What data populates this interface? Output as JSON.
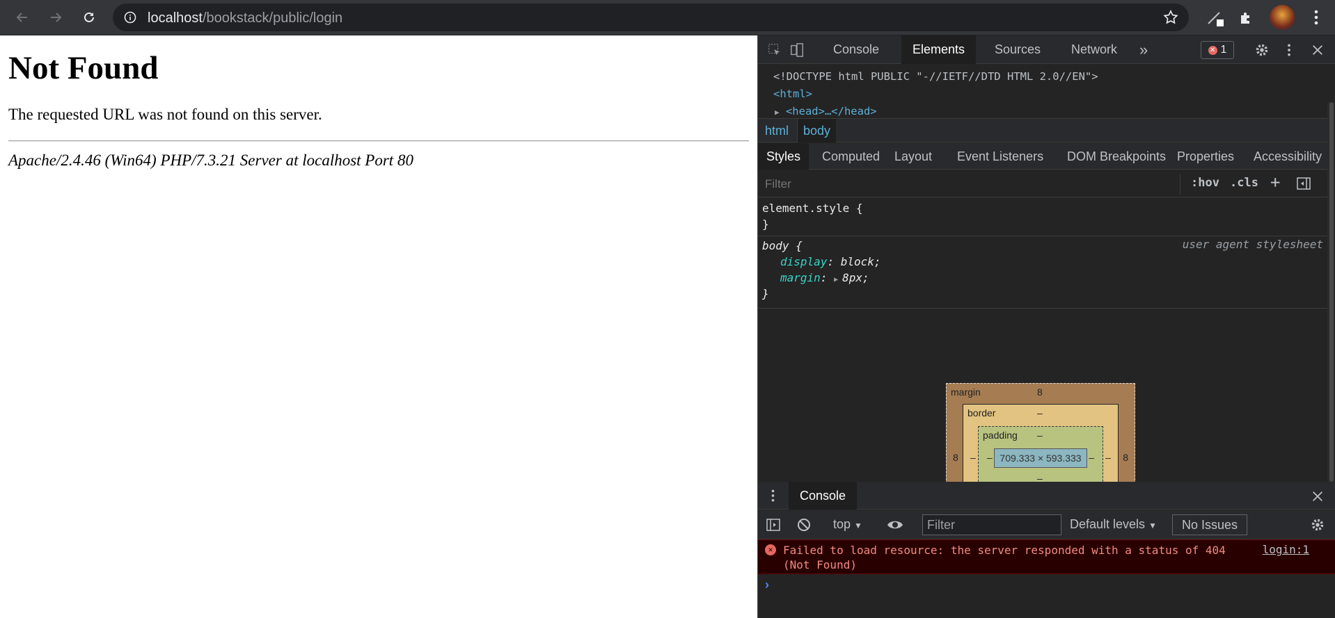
{
  "browser": {
    "url_host": "localhost",
    "url_path": "/bookstack/public/login"
  },
  "page": {
    "heading": "Not Found",
    "message": "The requested URL was not found on this server.",
    "server_signature": "Apache/2.4.46 (Win64) PHP/7.3.21 Server at localhost Port 80"
  },
  "devtools": {
    "main_tabs": [
      "Console",
      "Elements",
      "Sources",
      "Network"
    ],
    "active_main_tab": "Elements",
    "more_tabs_label": "»",
    "error_count": "1",
    "dom": {
      "doctype": "<!DOCTYPE html PUBLIC \"-//IETF//DTD HTML 2.0//EN\">",
      "html_open": "<html>",
      "head_collapsed": "<head>…</head>"
    },
    "breadcrumbs": [
      "html",
      "body"
    ],
    "sub_tabs": [
      "Styles",
      "Computed",
      "Layout",
      "Event Listeners",
      "DOM Breakpoints",
      "Properties",
      "Accessibility"
    ],
    "active_sub_tab": "Styles",
    "styles_filter_placeholder": "Filter",
    "hov_label": ":hov",
    "cls_label": ".cls",
    "plus_label": "+",
    "rules": {
      "element_style_open": "element.style {",
      "close": "}",
      "body_selector": "body {",
      "body_source": "user agent stylesheet",
      "display_prop": "display",
      "display_val": "block;",
      "margin_prop": "margin",
      "margin_val": "8px;"
    },
    "box_model": {
      "margin_label": "margin",
      "margin_top": "8",
      "margin_left": "8",
      "margin_right": "8",
      "border_label": "border",
      "border_value": "–",
      "padding_label": "padding",
      "padding_value": "–",
      "content_size": "709.333 × 593.333"
    },
    "drawer": {
      "tab": "Console",
      "context": "top",
      "filter_placeholder": "Filter",
      "levels": "Default levels",
      "issues": "No Issues",
      "error_message": "Failed to load resource: the server responded with a status of 404 (Not Found)",
      "error_source": "login:1",
      "prompt": "›"
    }
  },
  "colors": {
    "chrome_bg": "#35363a",
    "devtools_bg": "#242424",
    "error_bg": "#290000",
    "link_blue": "#5db0d7"
  }
}
